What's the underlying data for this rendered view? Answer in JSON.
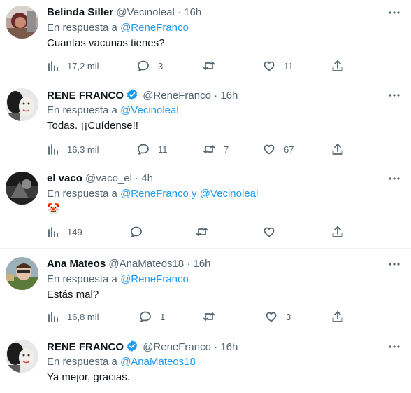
{
  "reply_prefix": "En respuesta a",
  "reply_joiner": "y",
  "dot": "·",
  "colors": {
    "accent": "#1d9bf0",
    "muted": "#536471",
    "text": "#0f1419",
    "divider": "#eff3f4"
  },
  "icons": {
    "views": "bar-chart-icon",
    "reply": "reply-bubble-icon",
    "retweet": "retweet-icon",
    "like": "heart-icon",
    "share": "share-icon",
    "more": "more-dots-icon",
    "verified": "verified-badge-icon"
  },
  "tweets": [
    {
      "name": "Belinda Siller",
      "handle": "@Vecinoleal",
      "time": "16h",
      "reply_to": [
        "@ReneFranco"
      ],
      "text": "Cuantas vacunas tienes?",
      "views": "17,2 mil",
      "replies": "3",
      "retweets": "",
      "likes": "11"
    },
    {
      "name": "RENE FRANCO",
      "verified": true,
      "handle": "@ReneFranco",
      "time": "16h",
      "reply_to": [
        "@Vecinoleal"
      ],
      "text": "Todas. ¡¡Cuídense!!",
      "views": "16,3 mil",
      "replies": "11",
      "retweets": "7",
      "likes": "67"
    },
    {
      "name": "el vaco",
      "handle": "@vaco_el",
      "time": "4h",
      "reply_to": [
        "@ReneFranco",
        "@Vecinoleal"
      ],
      "text": "🤡",
      "views": "149",
      "replies": "",
      "retweets": "",
      "likes": ""
    },
    {
      "name": "Ana Mateos",
      "handle": "@AnaMateos18",
      "time": "16h",
      "reply_to": [
        "@ReneFranco"
      ],
      "text": "Estás mal?",
      "views": "16,8 mil",
      "replies": "1",
      "retweets": "",
      "likes": "3"
    },
    {
      "name": "RENE FRANCO",
      "verified": true,
      "handle": "@ReneFranco",
      "time": "16h",
      "reply_to": [
        "@AnaMateos18"
      ],
      "text": "Ya mejor, gracias.",
      "views": "",
      "replies": "",
      "retweets": "",
      "likes": ""
    }
  ]
}
